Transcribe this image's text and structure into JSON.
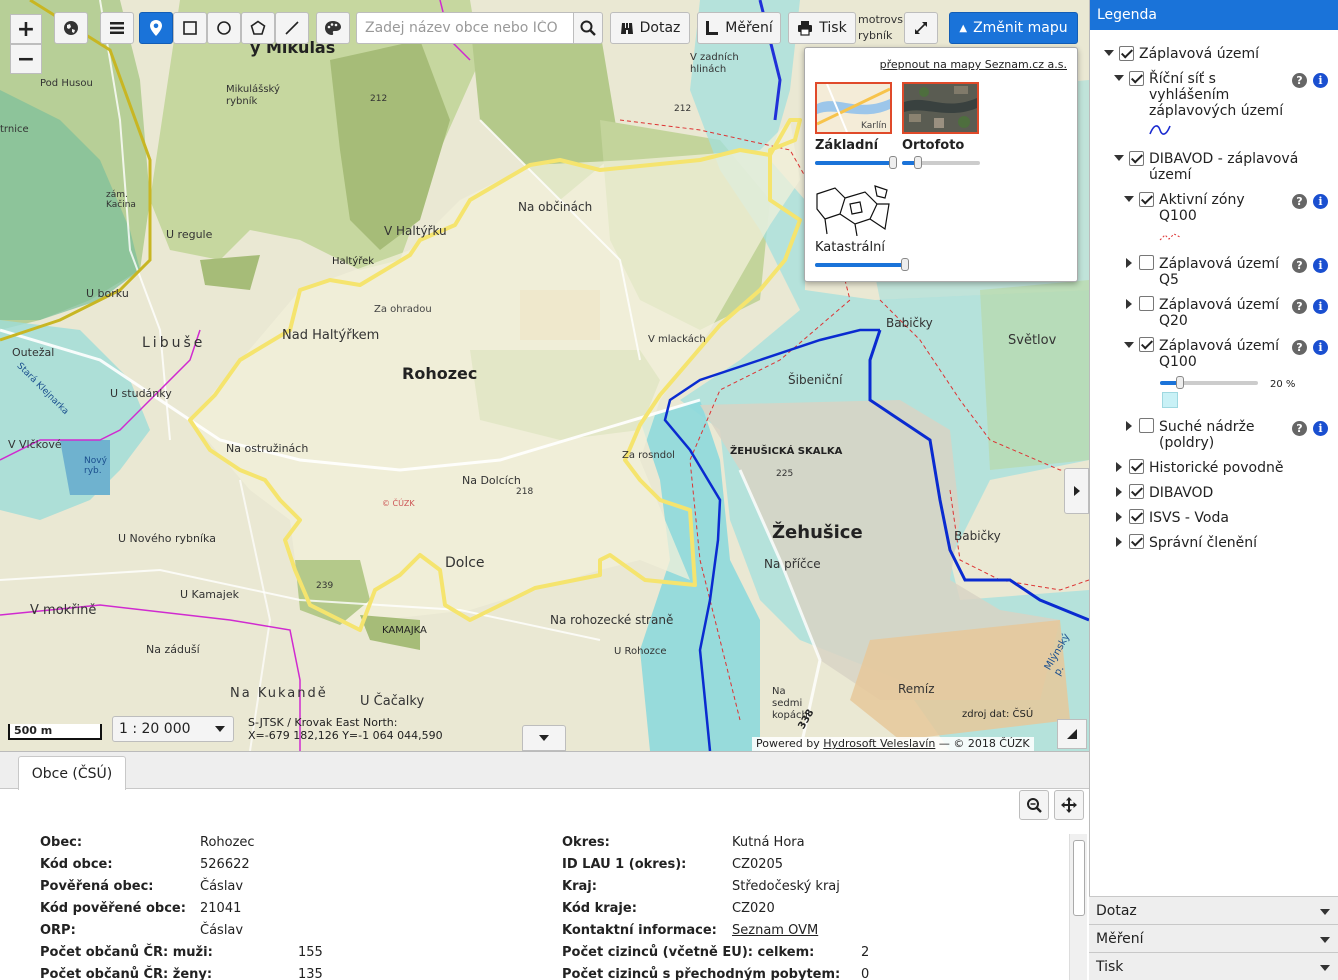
{
  "toolbar": {
    "search_placeholder": "Zadej název obce nebo IČO",
    "query_label": "Dotaz",
    "measure_label": "Měření",
    "print_label": "Tisk",
    "change_map_label": "Změnit mapu"
  },
  "basemap_panel": {
    "switch_link": "přepnout na mapy Seznam.cz a.s.",
    "basic_label": "Základní",
    "ortho_label": "Ortofoto",
    "cadastral_label": "Katastrální",
    "thumb_text": "Karlín",
    "basic_opacity": 1.0,
    "ortho_opacity": 0.2,
    "cadastral_opacity": 1.0
  },
  "map": {
    "scale_bar_label": "500 m",
    "scale_value": "1 : 20 000",
    "crs_label": "S-JTSK / Krovak East North:",
    "coords": "X=-679 182,126 Y=-1 064 044,590",
    "credits_prefix": "Powered by",
    "credits_link": "Hydrosoft Veleslavín",
    "credits_suffix": "— © 2018 ČÚZK",
    "data_source": "zdroj dat: ČSÚ",
    "labels": {
      "rohozec": "Rohozec",
      "zehusice": "Žehušice",
      "libuse": "Libuše",
      "dolce": "Dolce",
      "mikulas": "ý Mikuláš",
      "na_obcinach": "Na občinách",
      "v_haltyrku": "V Haltýřku",
      "haltyrek": "Haltýřek",
      "za_ohradou": "Za ohradou",
      "nad_haltyrkem": "Nad Haltýřkem",
      "u_regule": "U regule",
      "u_borku": "U borku",
      "outezal": "Outežal",
      "u_studanky": "U studánky",
      "na_ostruzinach": "Na ostružinách",
      "v_vlckove": "V Vlčkové",
      "novy_ryb": "Nový ryb.",
      "u_noveho_rybnika": "U Nového rybníka",
      "v_mokrine": "V mokřině",
      "u_kamajek": "U Kamajek",
      "na_zaduse": "Na záduší",
      "na_kukande": "Na Kukandě",
      "u_cacalky": "U Čačalky",
      "kamajka": "KAMAJKA",
      "na_rohozecke_strane": "Na rohozecké straně",
      "u_rohozce": "U Rohozce",
      "na_dolcich": "Na Dolcích",
      "za_rosndol": "Za rosndol",
      "v_mlackach": "V mlackách",
      "zehusicka_skalka": "ŽEHUŠICKÁ SKALKA",
      "na_pricce": "Na příčce",
      "sibenicni": "Šibeniční",
      "babicky": "Babičky",
      "babicky2": "Babičky",
      "svetlov": "Světlov",
      "motrovsky_rybnik": "motrovský rybník",
      "v_zadnich_hlinach": "V zadních hlinách",
      "pod_husou": "Pod Husou",
      "mikulasky_rybnik": "Mikulášský rybník",
      "remiz": "Remíz",
      "na_sedmi_kopach": "Na sedmi kopách",
      "cuzk": "© ČÚZK",
      "zam_kacina": "zám. Kačina",
      "trnice": "trnice",
      "mlynsky": "Mlýnský p.",
      "stara_klejnarka": "Stará Klejnarka",
      "h212": "212",
      "h212b": "212",
      "h218": "218",
      "h225": "225",
      "h239": "239",
      "r338": "338"
    }
  },
  "bottom_panel": {
    "tab_label": "Obce (ČSÚ)",
    "left": [
      {
        "k": "Obec:",
        "v": "Rohozec"
      },
      {
        "k": "Kód obce:",
        "v": "526622"
      },
      {
        "k": "Pověřená obec:",
        "v": "Čáslav"
      },
      {
        "k": "Kód pověřené obce:",
        "v": "21041"
      },
      {
        "k": "ORP:",
        "v": "Čáslav"
      },
      {
        "k": "Počet občanů ČR: muži:",
        "v": "155"
      },
      {
        "k": "Počet občanů ČR: ženy:",
        "v": "135"
      }
    ],
    "right": [
      {
        "k": "Okres:",
        "v": "Kutná Hora"
      },
      {
        "k": "ID LAU 1 (okres):",
        "v": "CZ0205"
      },
      {
        "k": "Kraj:",
        "v": "Středočeský kraj"
      },
      {
        "k": "Kód kraje:",
        "v": "CZ020"
      },
      {
        "k": "Kontaktní informace:",
        "v": "Seznam OVM"
      },
      {
        "k": "Počet cizinců (včetně EU): celkem:",
        "v": "2"
      },
      {
        "k": "Počet cizinců s přechodným pobytem:",
        "v": "0"
      }
    ]
  },
  "legend": {
    "title": "Legenda",
    "zaplavova_uzemi": "Záplavová území",
    "ricni_sit": "Říční síť s vyhlášením záplavových území",
    "dibavod_zaplavova": "DIBAVOD - záplavová území",
    "aktivni_zony": "Aktivní zóny Q100",
    "zu_q5": "Záplavová území Q5",
    "zu_q20": "Záplavová území Q20",
    "zu_q100": "Záplavová území Q100",
    "q100_opacity_label": "20 %",
    "q100_opacity": 0.2,
    "suche_nadrze": "Suché nádrže (poldry)",
    "historicke": "Historické povodně",
    "dibavod": "DIBAVOD",
    "isvs": "ISVS - Voda",
    "spravni": "Správní členění",
    "help": "?",
    "info": "i"
  },
  "accordion": {
    "dotaz": "Dotaz",
    "mereni": "Měření",
    "tisk": "Tisk"
  },
  "colors": {
    "accent": "#1a73d9",
    "flood_zone": "#9fe0e6",
    "municipal_boundary": "#f3e46a",
    "river": "#0a2bd0",
    "forest": "#a8bf7a",
    "field": "#ece9d2"
  }
}
